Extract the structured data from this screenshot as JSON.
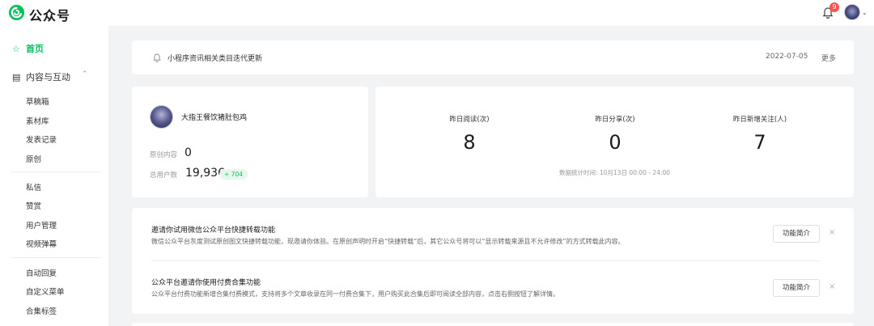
{
  "header": {
    "brand": "公众号",
    "notifications_count": "9"
  },
  "sidebar": {
    "home": "首页",
    "group_content": "内容与互动",
    "group1": [
      "草稿箱",
      "素材库",
      "发表记录",
      "原创"
    ],
    "group2": [
      "私信",
      "赞赏",
      "用户管理",
      "视频弹幕"
    ],
    "group3": [
      "自动回复",
      "自定义菜单",
      "合集标签"
    ]
  },
  "notice": {
    "text": "小程序资讯相关类目迭代更新",
    "date": "2022-07-05",
    "more": "更多"
  },
  "account": {
    "name": "大指王餐饮猪肚包鸡",
    "original_label": "原创内容",
    "original_value": "0",
    "users_label": "总用户数",
    "users_value": "19,936",
    "users_delta": "+ 704"
  },
  "stats": {
    "items": [
      {
        "label": "昨日阅读(次)",
        "value": "8"
      },
      {
        "label": "昨日分享(次)",
        "value": "0"
      },
      {
        "label": "昨日新增关注(人)",
        "value": "7"
      }
    ],
    "footnote": "数据统计时间: 10月13日 00:00 - 24:00"
  },
  "invites": [
    {
      "title": "邀请你试用微信公众平台快捷转载功能",
      "desc": "微信公众平台灰度测试原创图文快捷转载功能，现邀请你体验。在原创声明时开启“快捷转载”后，其它公众号将可以“显示转载来源且不允许修改”的方式转载此内容。",
      "button": "功能简介",
      "close": "×"
    },
    {
      "title": "公众平台邀请你使用付费合集功能",
      "desc": "公众平台付费功能新增合集付费模式，支持将多个文章收录在同一付费合集下，用户购买此合集后即可阅读全部内容，点击右侧按钮了解详情。",
      "button": "功能简介",
      "close": "×"
    }
  ],
  "colors": {
    "accent": "#07c160",
    "badge": "#fa5151",
    "background": "#f2f3f5"
  }
}
